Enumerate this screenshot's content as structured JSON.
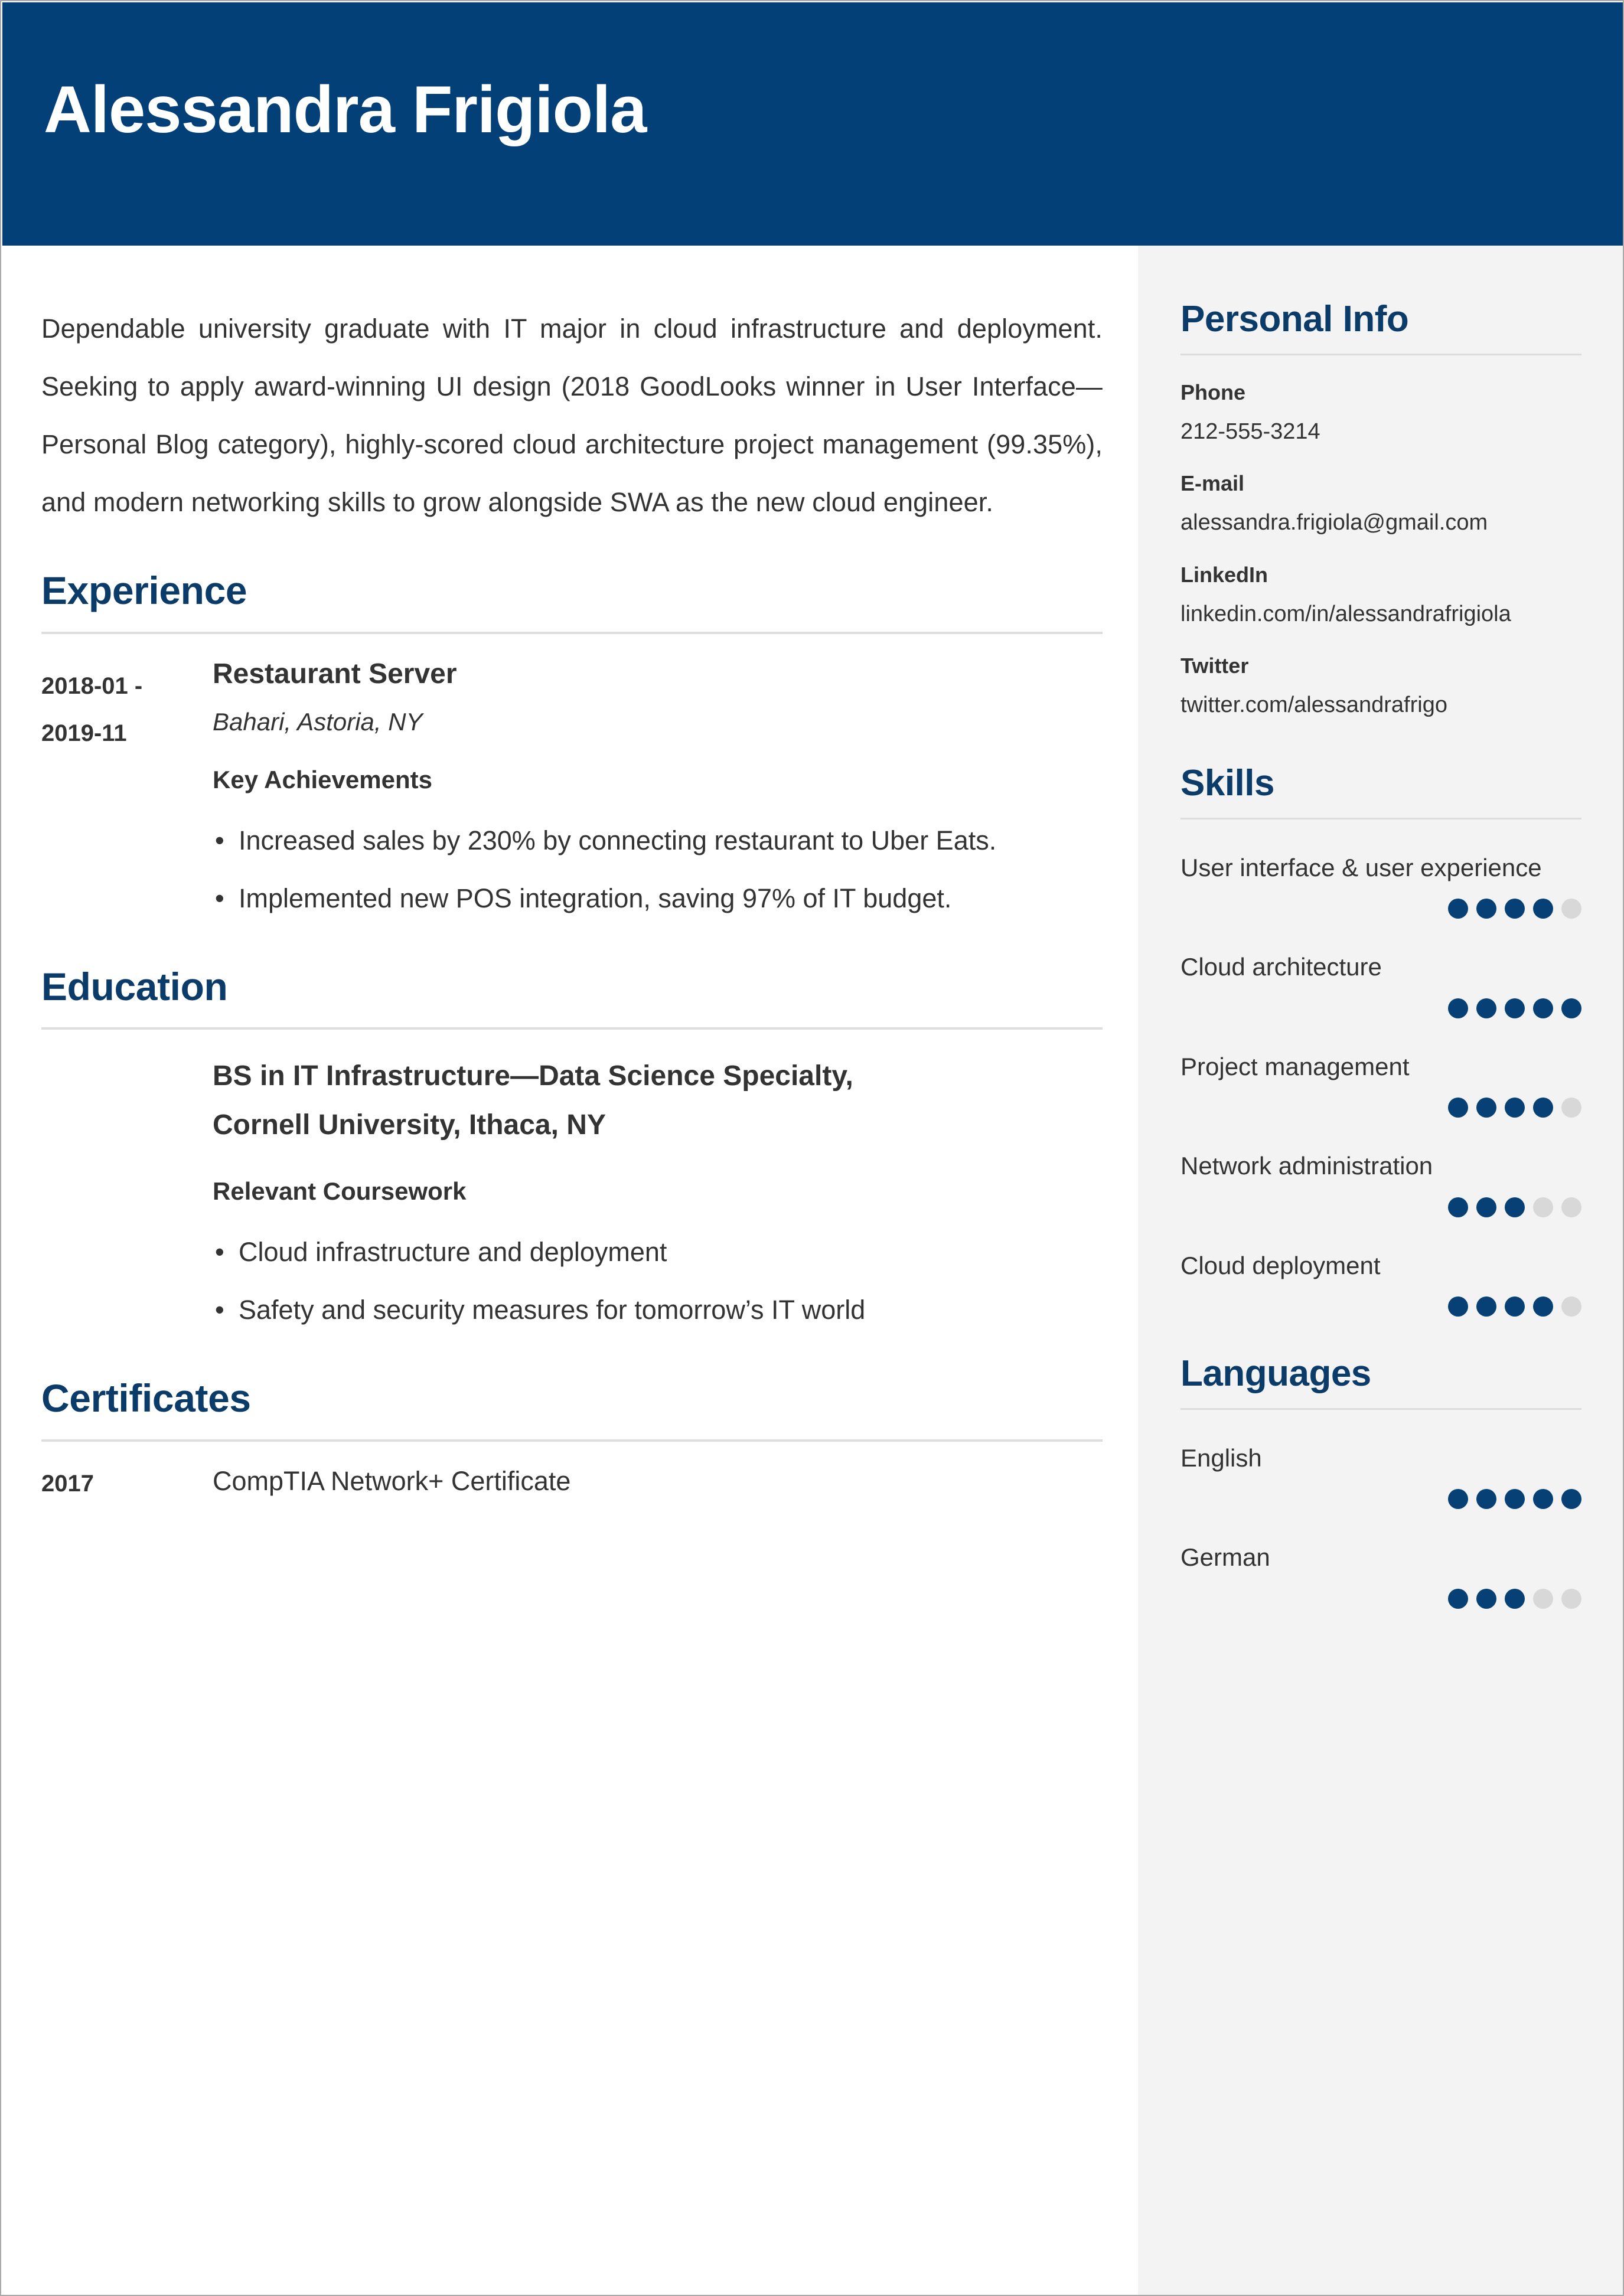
{
  "colors": {
    "header_bg": "#044078",
    "accent": "#0b3b69",
    "dot_filled": "#064074",
    "dot_empty": "#d8d8d8",
    "sidebar_bg": "#f3f3f3",
    "text": "#333333",
    "rule": "#dedede"
  },
  "header": {
    "name": "Alessandra Frigiola"
  },
  "main": {
    "summary": "Dependable university graduate with IT major in cloud infrastructure and deployment. Seeking to apply award-winning UI design (2018 GoodLooks winner in User Interface—Personal Blog category), highly-scored cloud architecture project management (99.35%), and modern networking skills to grow alongside SWA as the new cloud engineer.",
    "experience": {
      "title": "Experience",
      "entries": [
        {
          "date_from": "2018-01 -",
          "date_to": "2019-11",
          "job_title": "Restaurant Server",
          "company": "Bahari, Astoria, NY",
          "achievements_label": "Key Achievements",
          "achievements": [
            "Increased sales by 230% by connecting restaurant to Uber Eats.",
            "Implemented new POS integration, saving 97% of IT budget."
          ]
        }
      ]
    },
    "education": {
      "title": "Education",
      "entries": [
        {
          "degree_line1": "BS in IT Infrastructure—Data Science Specialty,",
          "degree_line2": "Cornell University, Ithaca, NY",
          "coursework_label": "Relevant Coursework",
          "coursework": [
            "Cloud infrastructure and deployment",
            "Safety and security measures for tomorrow’s IT world"
          ]
        }
      ]
    },
    "certificates": {
      "title": "Certificates",
      "entries": [
        {
          "year": "2017",
          "name": "CompTIA Network+ Certificate"
        }
      ]
    }
  },
  "sidebar": {
    "personal_info": {
      "title": "Personal Info",
      "fields": [
        {
          "label": "Phone",
          "value": "212-555-3214"
        },
        {
          "label": "E-mail",
          "value": "alessandra.frigiola@gmail.com"
        },
        {
          "label": "LinkedIn",
          "value": "linkedin.com/in/alessandrafrigiola"
        },
        {
          "label": "Twitter",
          "value": "twitter.com/alessandrafrigo"
        }
      ]
    },
    "skills": {
      "title": "Skills",
      "max_rating": 5,
      "items": [
        {
          "label": "User interface & user experience",
          "rating": 4
        },
        {
          "label": "Cloud architecture",
          "rating": 5
        },
        {
          "label": "Project management",
          "rating": 4
        },
        {
          "label": "Network administration",
          "rating": 3
        },
        {
          "label": "Cloud deployment",
          "rating": 4
        }
      ]
    },
    "languages": {
      "title": "Languages",
      "max_rating": 5,
      "items": [
        {
          "label": "English",
          "rating": 5
        },
        {
          "label": "German",
          "rating": 3
        }
      ]
    }
  }
}
